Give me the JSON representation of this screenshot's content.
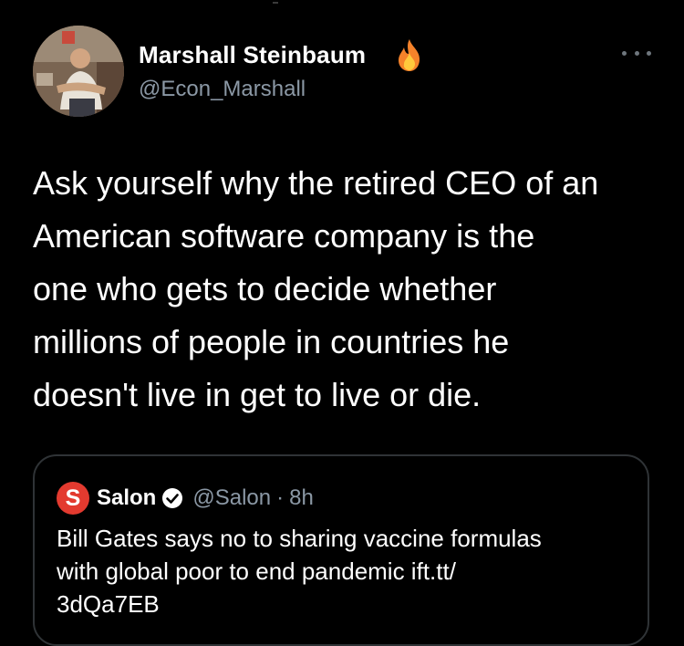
{
  "tweet": {
    "author_name": "Marshall Steinbaum",
    "author_handle": "@Econ_Marshall",
    "name_emoji_icon": "fire-icon",
    "more_icon": "more-options-icon",
    "text": "Ask yourself why the retired CEO of an\nAmerican software company is the\none who gets to decide whether\nmillions of people in countries he\ndoesn't live in get to live or die."
  },
  "quoted_tweet": {
    "logo_letter": "S",
    "author_name": "Salon",
    "verified_icon": "verified-badge-icon",
    "author_handle": "@Salon",
    "separator": "·",
    "time": "8h",
    "text": "Bill Gates says no to sharing vaccine formulas\nwith global poor to end pandemic ift.tt/\n3dQa7EB"
  },
  "colors": {
    "background": "#000000",
    "primary_text": "#ffffff",
    "secondary_text": "#8b98a5",
    "card_border": "#2f3336",
    "salon_red": "#e33a2f"
  }
}
